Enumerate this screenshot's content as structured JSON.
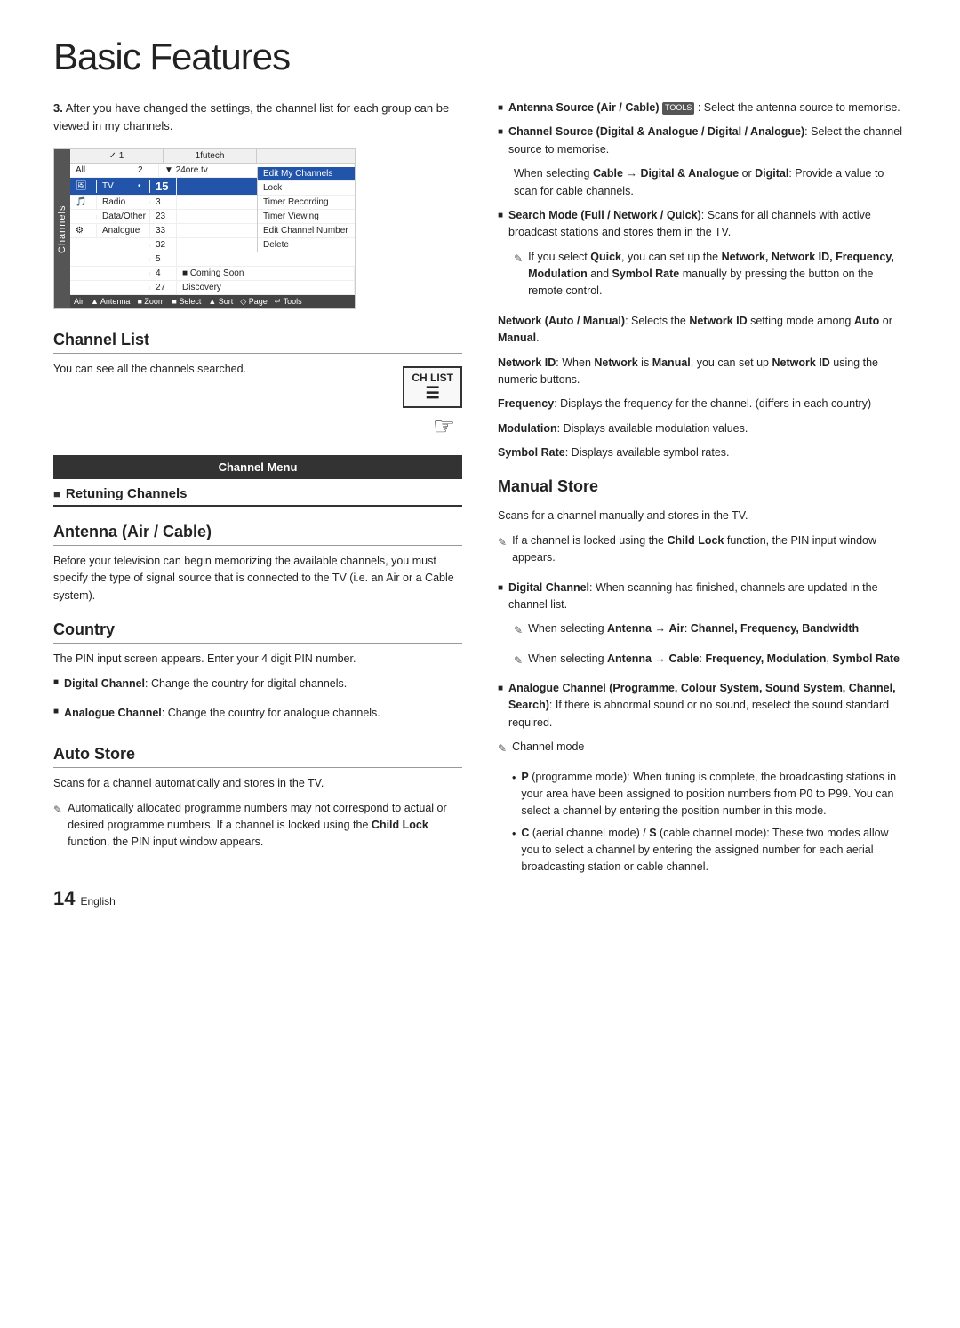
{
  "page": {
    "title": "Basic Features",
    "number": "14",
    "language": "English"
  },
  "step3": {
    "text": "After you have changed the settings, the channel list for each group can be viewed in my channels."
  },
  "tv_screenshot": {
    "sidebar_label": "Channels",
    "header": [
      "✓ 1",
      "1futech"
    ],
    "rows": [
      {
        "col1": "All",
        "col2": "2",
        "col3": "▼ 24ore.tv"
      },
      {
        "col1": "TV",
        "col2": "•",
        "col3": "15",
        "highlight": true
      },
      {
        "col1": "Radio",
        "col2": "3",
        "col3": ""
      },
      {
        "col1": "Data/Other",
        "col2": "23",
        "col3": ""
      },
      {
        "col1": "Analogue",
        "col2": "33",
        "col3": ""
      },
      {
        "col1": "",
        "col2": "32",
        "col3": ""
      },
      {
        "col1": "",
        "col2": "5",
        "col3": ""
      },
      {
        "col1": "",
        "col2": "4",
        "col3": "■ Coming Soon"
      },
      {
        "col1": "",
        "col2": "27",
        "col3": "Discovery"
      }
    ],
    "menu_items": [
      "Edit My Channels",
      "Lock",
      "Timer Recording",
      "Timer Viewing",
      "Edit Channel Number",
      "Delete"
    ],
    "footer": [
      "Air",
      "▲ Antenna",
      "■ Zoom",
      "■ Select",
      "▲ Sort",
      "◇ Page",
      "↵ Tools"
    ]
  },
  "channel_list": {
    "heading": "Channel List",
    "text": "You can see all the channels searched.",
    "ch_list_label": "CH LIST"
  },
  "channel_menu": {
    "label": "Channel Menu"
  },
  "retuning": {
    "heading": "Retuning Channels"
  },
  "antenna": {
    "heading": "Antenna (Air / Cable)",
    "text": "Before your television can begin memorizing the available channels, you must specify the type of signal source that is connected to the TV (i.e. an Air or a Cable system)."
  },
  "country": {
    "heading": "Country",
    "text": "The PIN input screen appears. Enter your 4 digit PIN number.",
    "bullets": [
      {
        "label": "Digital Channel",
        "text": ": Change the country for digital channels."
      },
      {
        "label": "Analogue Channel",
        "text": ": Change the country for analogue channels."
      }
    ]
  },
  "auto_store": {
    "heading": "Auto Store",
    "text": "Scans for a channel automatically and stores in the TV.",
    "pencil_text": "Automatically allocated programme numbers may not correspond to actual or desired programme numbers. If a channel is locked using the Child Lock function, the PIN input window appears."
  },
  "right_col": {
    "antenna_source": {
      "label": "Antenna Source (Air / Cable)",
      "tools_badge": "TOOLS",
      "text": ": Select the antenna source to memorise."
    },
    "channel_source": {
      "label": "Channel Source (Digital & Analogue / Digital / Analogue)",
      "text": ": Select the channel source to memorise."
    },
    "cable_note": "When selecting Cable → Digital & Analogue or Digital: Provide a value to scan for cable channels.",
    "search_mode": {
      "label": "Search Mode (Full / Network / Quick)",
      "text": ": Scans for all channels with active broadcast stations and stores them in the TV."
    },
    "quick_note": "If you select Quick, you can set up the Network, Network ID, Frequency, Modulation and Symbol Rate manually by pressing the button on the remote control.",
    "network_auto": {
      "label": "Network (Auto / Manual)",
      "text": ": Selects the Network ID setting mode among Auto or Manual."
    },
    "network_id": {
      "label": "Network ID",
      "text": ": When Network is Manual, you can set up Network ID using the numeric buttons."
    },
    "frequency": {
      "label": "Frequency",
      "text": ": Displays the frequency for the channel. (differs in each country)"
    },
    "modulation": {
      "label": "Modulation",
      "text": ": Displays available modulation values."
    },
    "symbol_rate": {
      "label": "Symbol Rate",
      "text": ": Displays available symbol rates."
    }
  },
  "manual_store": {
    "heading": "Manual Store",
    "text": "Scans for a channel manually and stores in the TV.",
    "child_lock_note": "If a channel is locked using the Child Lock function, the PIN input window appears.",
    "digital_channel": {
      "label": "Digital Channel",
      "text": ": When scanning has finished, channels are updated in the channel list."
    },
    "antenna_air": {
      "pencil": "When selecting Antenna → Air: Channel, Frequency, Bandwidth"
    },
    "antenna_cable": {
      "pencil": "When selecting Antenna → Cable: Frequency, Modulation, Symbol Rate"
    },
    "analogue_channel": {
      "label": "Analogue Channel (Programme, Colour System, Sound System, Channel, Search)",
      "text": ": If there is abnormal sound or no sound, reselect the sound standard required."
    },
    "channel_mode_label": "Channel mode",
    "sub_bullets": [
      {
        "label": "P",
        "text": " (programme mode): When tuning is complete, the broadcasting stations in your area have been assigned to position numbers from P0 to P99. You can select a channel by entering the position number in this mode."
      },
      {
        "label": "C",
        "text": " (aerial channel mode) / S (cable channel mode): These two modes allow you to select a channel by entering the assigned number for each aerial broadcasting station or cable channel."
      }
    ]
  }
}
